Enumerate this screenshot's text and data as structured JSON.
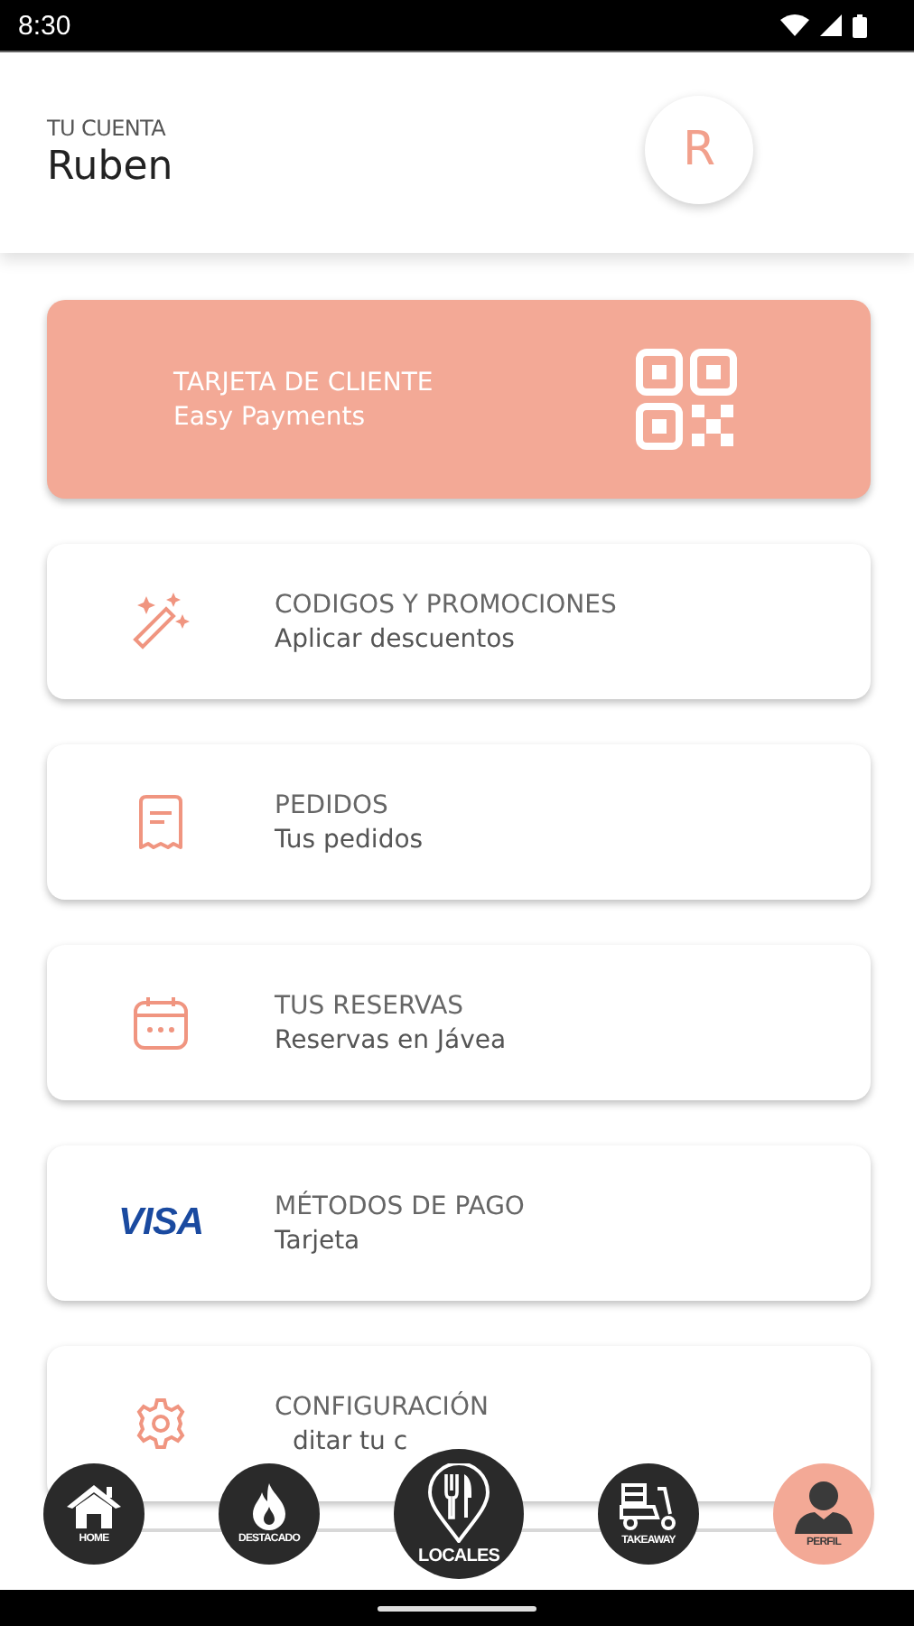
{
  "status_bar": {
    "time": "8:30"
  },
  "header": {
    "caption": "TU CUENTA",
    "name": "Ruben",
    "avatar_initial": "R"
  },
  "client_card": {
    "title": "TARJETA DE CLIENTE",
    "subtitle": "Easy Payments"
  },
  "menu": [
    {
      "kind": "magic",
      "title": "CODIGOS Y PROMOCIONES",
      "subtitle": "Aplicar descuentos"
    },
    {
      "kind": "receipt",
      "title": "PEDIDOS",
      "subtitle": "Tus pedidos"
    },
    {
      "kind": "calendar",
      "title": "TUS RESERVAS",
      "subtitle": "Reservas en Jávea"
    },
    {
      "kind": "visa",
      "logo_text": "VISA",
      "title": "MÉTODOS DE PAGO",
      "subtitle": "Tarjeta"
    },
    {
      "kind": "gear",
      "title": "CONFIGURACIÓN",
      "subtitle": "ditar tu c"
    }
  ],
  "bottom_nav": [
    {
      "kind": "home",
      "label": "HOME",
      "large": false,
      "selected": false
    },
    {
      "kind": "flame",
      "label": "DESTACADO",
      "large": false,
      "selected": false
    },
    {
      "kind": "pin",
      "label": "LOCALES",
      "large": true,
      "selected": false
    },
    {
      "kind": "scooter",
      "label": "TAKEAWAY",
      "large": false,
      "selected": false
    },
    {
      "kind": "person",
      "label": "PERFIL",
      "large": false,
      "selected": true
    }
  ]
}
